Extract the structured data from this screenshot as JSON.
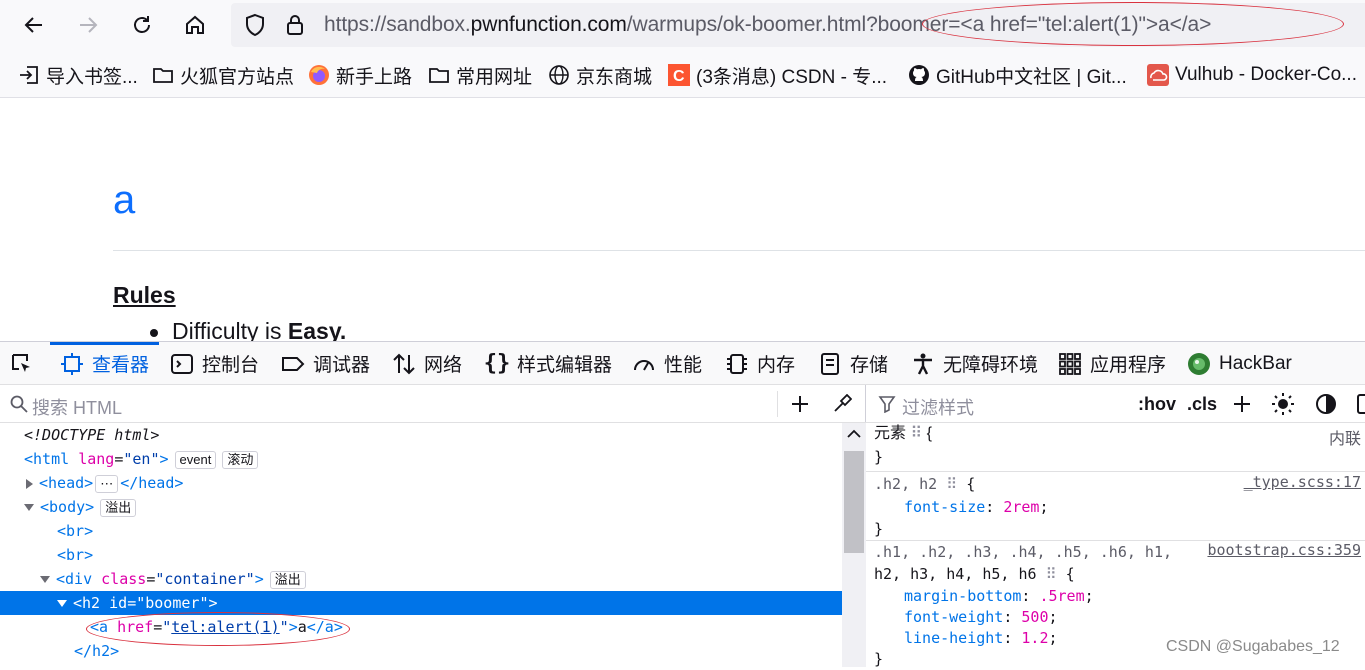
{
  "browser": {
    "url": {
      "prefix": "https://sandbox.",
      "domain": "pwnfunction.com",
      "path": "/warmups/ok-boomer.html",
      "query": "?boomer=<a href=\"tel:alert(1)\">a</a>"
    },
    "bookmarks": [
      {
        "label": "导入书签...",
        "icon": "import-icon"
      },
      {
        "label": "火狐官方站点",
        "icon": "folder-icon"
      },
      {
        "label": "新手上路",
        "icon": "firefox-icon"
      },
      {
        "label": "常用网址",
        "icon": "folder-icon"
      },
      {
        "label": "京东商城",
        "icon": "globe-icon"
      },
      {
        "label": "(3条消息) CSDN - 专...",
        "icon": "csdn-icon"
      },
      {
        "label": "GitHub中文社区 | Git...",
        "icon": "github-icon"
      },
      {
        "label": "Vulhub - Docker-Co...",
        "icon": "vulhub-icon"
      }
    ]
  },
  "page": {
    "injected_link": "a",
    "rules_heading": "Rules",
    "rule_1_prefix": "Difficulty is ",
    "rule_1_bold": "Easy."
  },
  "devtools": {
    "tabs": [
      {
        "label": "查看器",
        "icon": "inspector-icon"
      },
      {
        "label": "控制台",
        "icon": "console-icon"
      },
      {
        "label": "调试器",
        "icon": "debugger-icon"
      },
      {
        "label": "网络",
        "icon": "network-icon"
      },
      {
        "label": "样式编辑器",
        "icon": "style-editor-icon"
      },
      {
        "label": "性能",
        "icon": "performance-icon"
      },
      {
        "label": "内存",
        "icon": "memory-icon"
      },
      {
        "label": "存储",
        "icon": "storage-icon"
      },
      {
        "label": "无障碍环境",
        "icon": "accessibility-icon"
      },
      {
        "label": "应用程序",
        "icon": "application-icon"
      },
      {
        "label": "HackBar",
        "icon": "hackbar-icon"
      }
    ],
    "search_placeholder": "搜索 HTML",
    "filter_placeholder": "过滤样式",
    "hov_label": ":hov",
    "cls_label": ".cls",
    "markup": {
      "doctype": "<!DOCTYPE html>",
      "html_lang": "en",
      "badge_event": "event",
      "badge_scroll": "滚动",
      "badge_overflow": "溢出",
      "div_class": "container",
      "h2_id": "boomer",
      "a_href": "tel:alert(1)",
      "a_text": "a"
    },
    "styles": {
      "element_label": "元素",
      "inline_label": "内联",
      "rule1_selector": ".h2, h2",
      "rule1_source": "_type.scss:17",
      "rule1_prop": "font-size",
      "rule1_value": "2rem",
      "rule2_selector_1": ".h1, .h2, .h3, .h4, .h5, .h6, h1,",
      "rule2_selector_2": "h2, h3, h4, h5, h6",
      "rule2_source": "bootstrap.css:359",
      "rule2_props": [
        {
          "prop": "margin-bottom",
          "value": ".5rem"
        },
        {
          "prop": "font-weight",
          "value": "500"
        },
        {
          "prop": "line-height",
          "value": "1.2"
        }
      ]
    }
  },
  "watermark": "CSDN @Sugababes_12",
  "colors": {
    "accent": "#0061e0",
    "annotation_red": "#d9323f",
    "link_blue": "#0d6efd"
  }
}
